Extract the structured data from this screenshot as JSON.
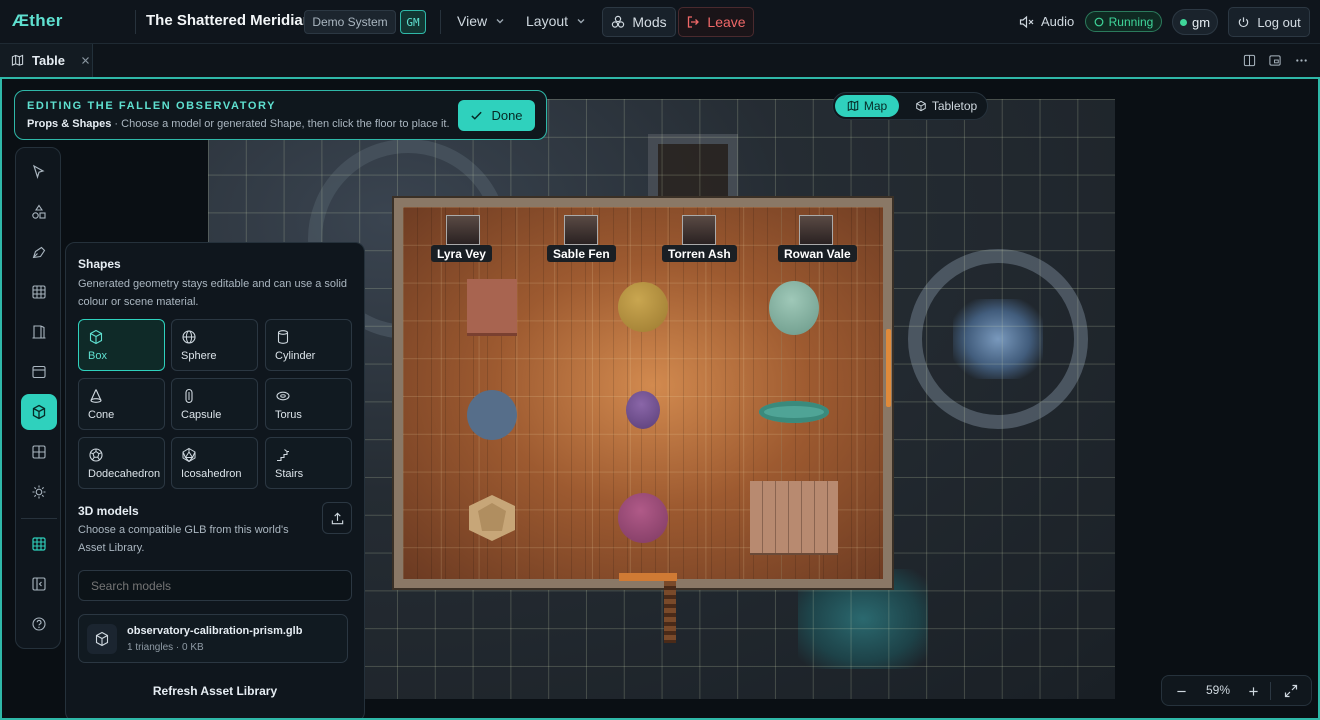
{
  "app": {
    "logo": "Æther",
    "campaign": "The Shattered Meridian",
    "system_badge": "Demo System",
    "role_badge": "GM"
  },
  "menu": {
    "view": "View",
    "layout": "Layout"
  },
  "actions": {
    "mods": "Mods",
    "leave": "Leave",
    "audio": "Audio",
    "status": "Running",
    "user": "gm",
    "logout": "Log out"
  },
  "tabs": [
    {
      "label": "Table"
    }
  ],
  "editing": {
    "title": "EDITING THE FALLEN OBSERVATORY",
    "subtitle_strong": "Props & Shapes",
    "subtitle": " · Choose a model or generated Shape, then click the floor to place it.",
    "done": "Done"
  },
  "view_toggle": {
    "map": "Map",
    "tabletop": "Tabletop",
    "active": "Map"
  },
  "tokens": [
    {
      "name": "Lyra Vey"
    },
    {
      "name": "Sable Fen"
    },
    {
      "name": "Torren Ash"
    },
    {
      "name": "Rowan Vale"
    }
  ],
  "tools": [
    "select-icon",
    "shapes-icon",
    "draw-icon",
    "grid-icon",
    "door-icon",
    "layer-icon",
    "box-icon",
    "tiles-icon",
    "light-icon",
    "map-grid-icon",
    "panel-icon",
    "help-icon"
  ],
  "panel": {
    "shapes_title": "Shapes",
    "shapes_desc": "Generated geometry stays editable and can use a solid colour or scene material.",
    "shapes": [
      {
        "label": "Box",
        "icon": "box-icon",
        "selected": true
      },
      {
        "label": "Sphere",
        "icon": "sphere-icon"
      },
      {
        "label": "Cylinder",
        "icon": "cylinder-icon"
      },
      {
        "label": "Cone",
        "icon": "cone-icon"
      },
      {
        "label": "Capsule",
        "icon": "capsule-icon"
      },
      {
        "label": "Torus",
        "icon": "torus-icon"
      },
      {
        "label": "Dodecahedron",
        "icon": "dodecahedron-icon"
      },
      {
        "label": "Icosahedron",
        "icon": "icosahedron-icon"
      },
      {
        "label": "Stairs",
        "icon": "stairs-icon"
      }
    ],
    "models_title": "3D models",
    "models_desc": "Choose a compatible GLB from this world's Asset Library.",
    "search_placeholder": "Search models",
    "model": {
      "name": "observatory-calibration-prism.glb",
      "meta": "1 triangles · 0 KB"
    },
    "refresh": "Refresh Asset Library"
  },
  "zoom": {
    "level": "59%"
  },
  "colors": {
    "accent": "#2fd1bd",
    "danger": "#f05a5a",
    "running": "#3fd69a"
  }
}
